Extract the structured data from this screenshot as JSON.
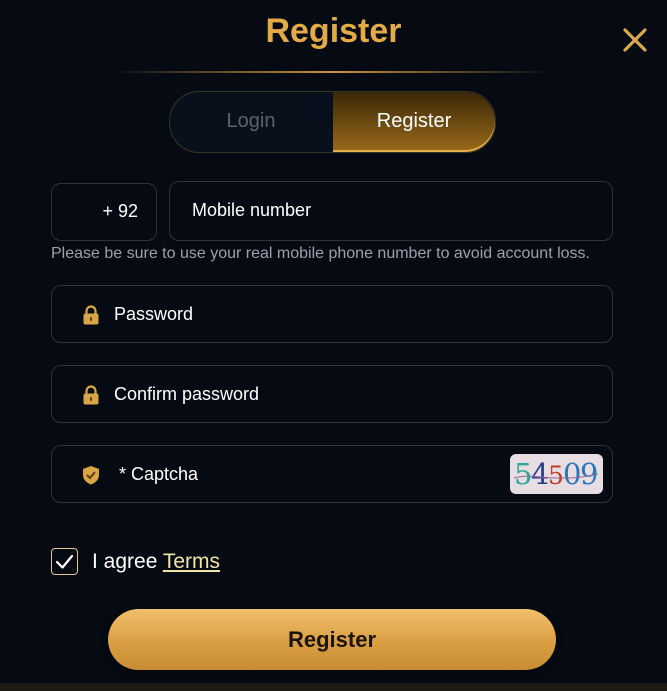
{
  "header": {
    "title": "Register",
    "close_icon": "close-icon"
  },
  "tabs": [
    {
      "label": "Login",
      "active": false
    },
    {
      "label": "Register",
      "active": true
    }
  ],
  "form": {
    "country_code": "+ 92",
    "mobile_placeholder": "Mobile number",
    "mobile_hint": "Please be sure to use your real mobile phone number to avoid account loss.",
    "password_placeholder": "Password",
    "confirm_password_placeholder": "Confirm password",
    "captcha_placeholder": "* Captcha",
    "captcha_code": "54509",
    "agree_text": "I agree",
    "terms_link": "Terms",
    "agree_checked": true,
    "submit_label": "Register"
  },
  "icons": {
    "password": "lock-icon",
    "confirm_password": "lock-icon",
    "captcha": "shield-check-icon"
  },
  "colors": {
    "accent_gold": "#e4aa45",
    "background": "#050a13",
    "button_gold": "#dca147"
  }
}
